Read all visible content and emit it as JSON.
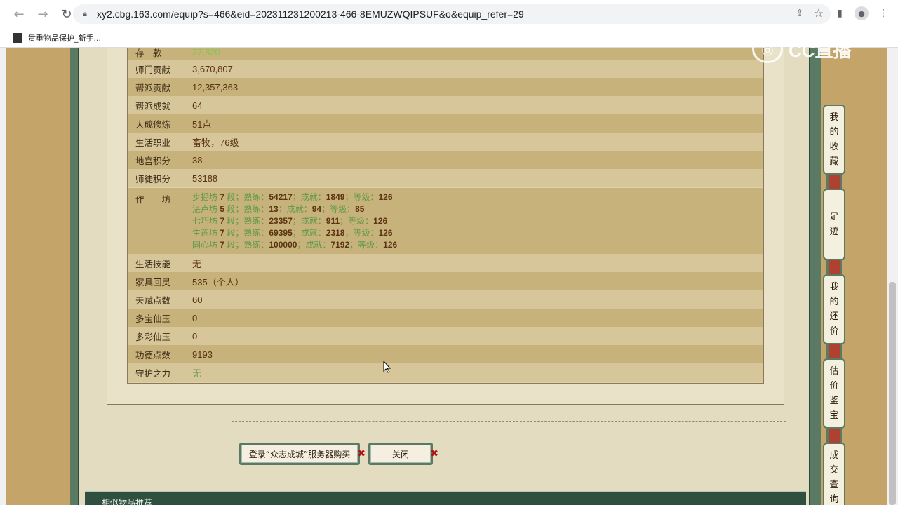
{
  "browser": {
    "url": "xy2.cbg.163.com/equip?s=466&eid=202311231200213-466-8EMUZWQIPSUF&o&equip_refer=29",
    "bookmark": "贵重物品保护_新手..."
  },
  "logo_text": "CC直播",
  "partial_row": {
    "label": "存　款",
    "value": "37,820"
  },
  "rows": [
    {
      "label": "师门贡献",
      "value": "3,670,807"
    },
    {
      "label": "帮派贡献",
      "value": "12,357,363"
    },
    {
      "label": "帮派成就",
      "value": "64"
    },
    {
      "label": "大成修炼",
      "value": "51点"
    },
    {
      "label": "生活职业",
      "value": "畜牧，76级"
    },
    {
      "label": "地宫积分",
      "value": "38"
    },
    {
      "label": "师徒积分",
      "value": "53188"
    }
  ],
  "workshop": {
    "label": "作　　坊",
    "lines": [
      {
        "name": "步摇坊",
        "seg": "7",
        "skill": "54217",
        "ach": "1849",
        "level": "126"
      },
      {
        "name": "湛卢坊",
        "seg": "5",
        "skill": "13",
        "ach": "94",
        "level": "85"
      },
      {
        "name": "七巧坊",
        "seg": "7",
        "skill": "23357",
        "ach": "911",
        "level": "126"
      },
      {
        "name": "生莲坊",
        "seg": "7",
        "skill": "69395",
        "ach": "2318",
        "level": "126"
      },
      {
        "name": "同心坊",
        "seg": "7",
        "skill": "100000",
        "ach": "7192",
        "level": "126"
      }
    ],
    "seg_unit": "段；",
    "skill_label": "熟练：",
    "ach_label": "；成就：",
    "level_label": "；等级："
  },
  "rows2": [
    {
      "label": "生活技能",
      "value": "无"
    },
    {
      "label": "家具回灵",
      "value": "535（个人）"
    },
    {
      "label": "天赋点数",
      "value": "60"
    },
    {
      "label": "多宝仙玉",
      "value": "0"
    },
    {
      "label": "多彩仙玉",
      "value": "0"
    },
    {
      "label": "功德点数",
      "value": "9193"
    },
    {
      "label": "守护之力",
      "value": "无"
    }
  ],
  "buttons": {
    "login_buy": "登录“众志成城”服务器购买",
    "close": "关闭"
  },
  "bottom_title": "相似物品推荐",
  "side_tabs": [
    "我的收藏",
    "足迹",
    "我的还价",
    "估价鉴宝",
    "成交查询"
  ]
}
